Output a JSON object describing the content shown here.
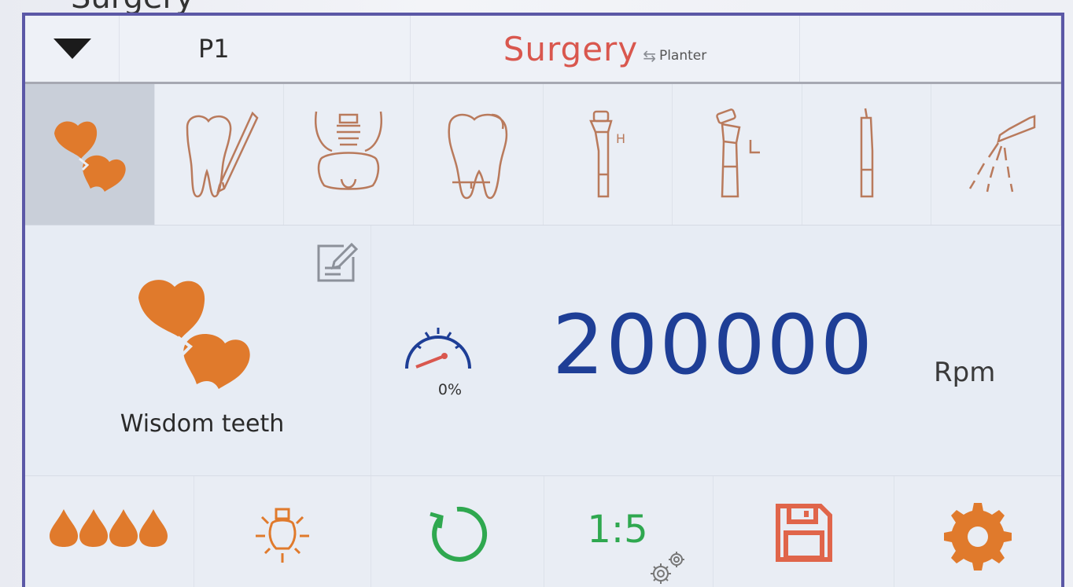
{
  "caption": "Surgery",
  "header": {
    "program": "P1",
    "mode": "Surgery",
    "alt_mode": "Planter",
    "swap_symbol": "⇆"
  },
  "tools": [
    {
      "name": "wisdom-teeth",
      "icon": "wisdom-teeth-icon",
      "active": true
    },
    {
      "name": "root-canal",
      "icon": "tooth-file-icon",
      "active": false
    },
    {
      "name": "implant",
      "icon": "implant-icon",
      "active": false
    },
    {
      "name": "restoration",
      "icon": "tooth-icon",
      "active": false
    },
    {
      "name": "high-speed",
      "icon": "handpiece-h-icon",
      "label": "H",
      "active": false
    },
    {
      "name": "low-speed",
      "icon": "handpiece-l-icon",
      "label": "L",
      "active": false
    },
    {
      "name": "scaler",
      "icon": "scaler-icon",
      "active": false
    },
    {
      "name": "water-spray",
      "icon": "spray-icon",
      "active": false
    }
  ],
  "main": {
    "preset_name": "Wisdom teeth",
    "load_percent": "0%",
    "speed_value": "200000",
    "speed_unit": "Rpm"
  },
  "bottom": {
    "water_level": 4,
    "ratio": "1:5"
  },
  "colors": {
    "accent_orange": "#e07a2c",
    "mode_red": "#d9574e",
    "speed_blue": "#1e3e96",
    "green": "#2fa84f",
    "frame": "#5b58a6"
  }
}
